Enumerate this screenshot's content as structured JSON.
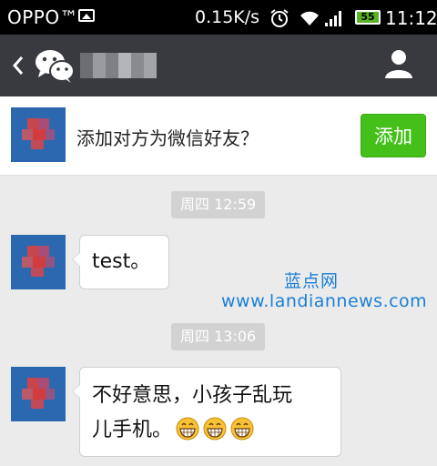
{
  "status_bar": {
    "carrier": "OPPO™",
    "speed": "0.15K/s",
    "battery": "55",
    "time": "11:12"
  },
  "header": {
    "contact_name_pixelated": true
  },
  "add_friend": {
    "prompt": "添加对方为微信好友？",
    "button_label": "添加",
    "button_color": "#45c01a"
  },
  "messages": [
    {
      "timestamp": "周四 12:59",
      "text": "test。"
    },
    {
      "timestamp": "周四 13:06",
      "line1": "不好意思，小孩子乱玩",
      "line2": "儿手机。",
      "emoji_count": 3
    }
  ],
  "watermark": {
    "title": "蓝点网",
    "url": "www.landiannews.com"
  },
  "colors": {
    "titlebar": "#393a3f",
    "background": "#ebebeb",
    "avatar": "#2c68b0",
    "watermark": "#1a7fd6"
  },
  "icons": [
    "back-icon",
    "wechat-icon",
    "profile-icon",
    "alarm-icon",
    "wifi-icon",
    "signal-icon",
    "image-icon",
    "grin-emoji"
  ]
}
